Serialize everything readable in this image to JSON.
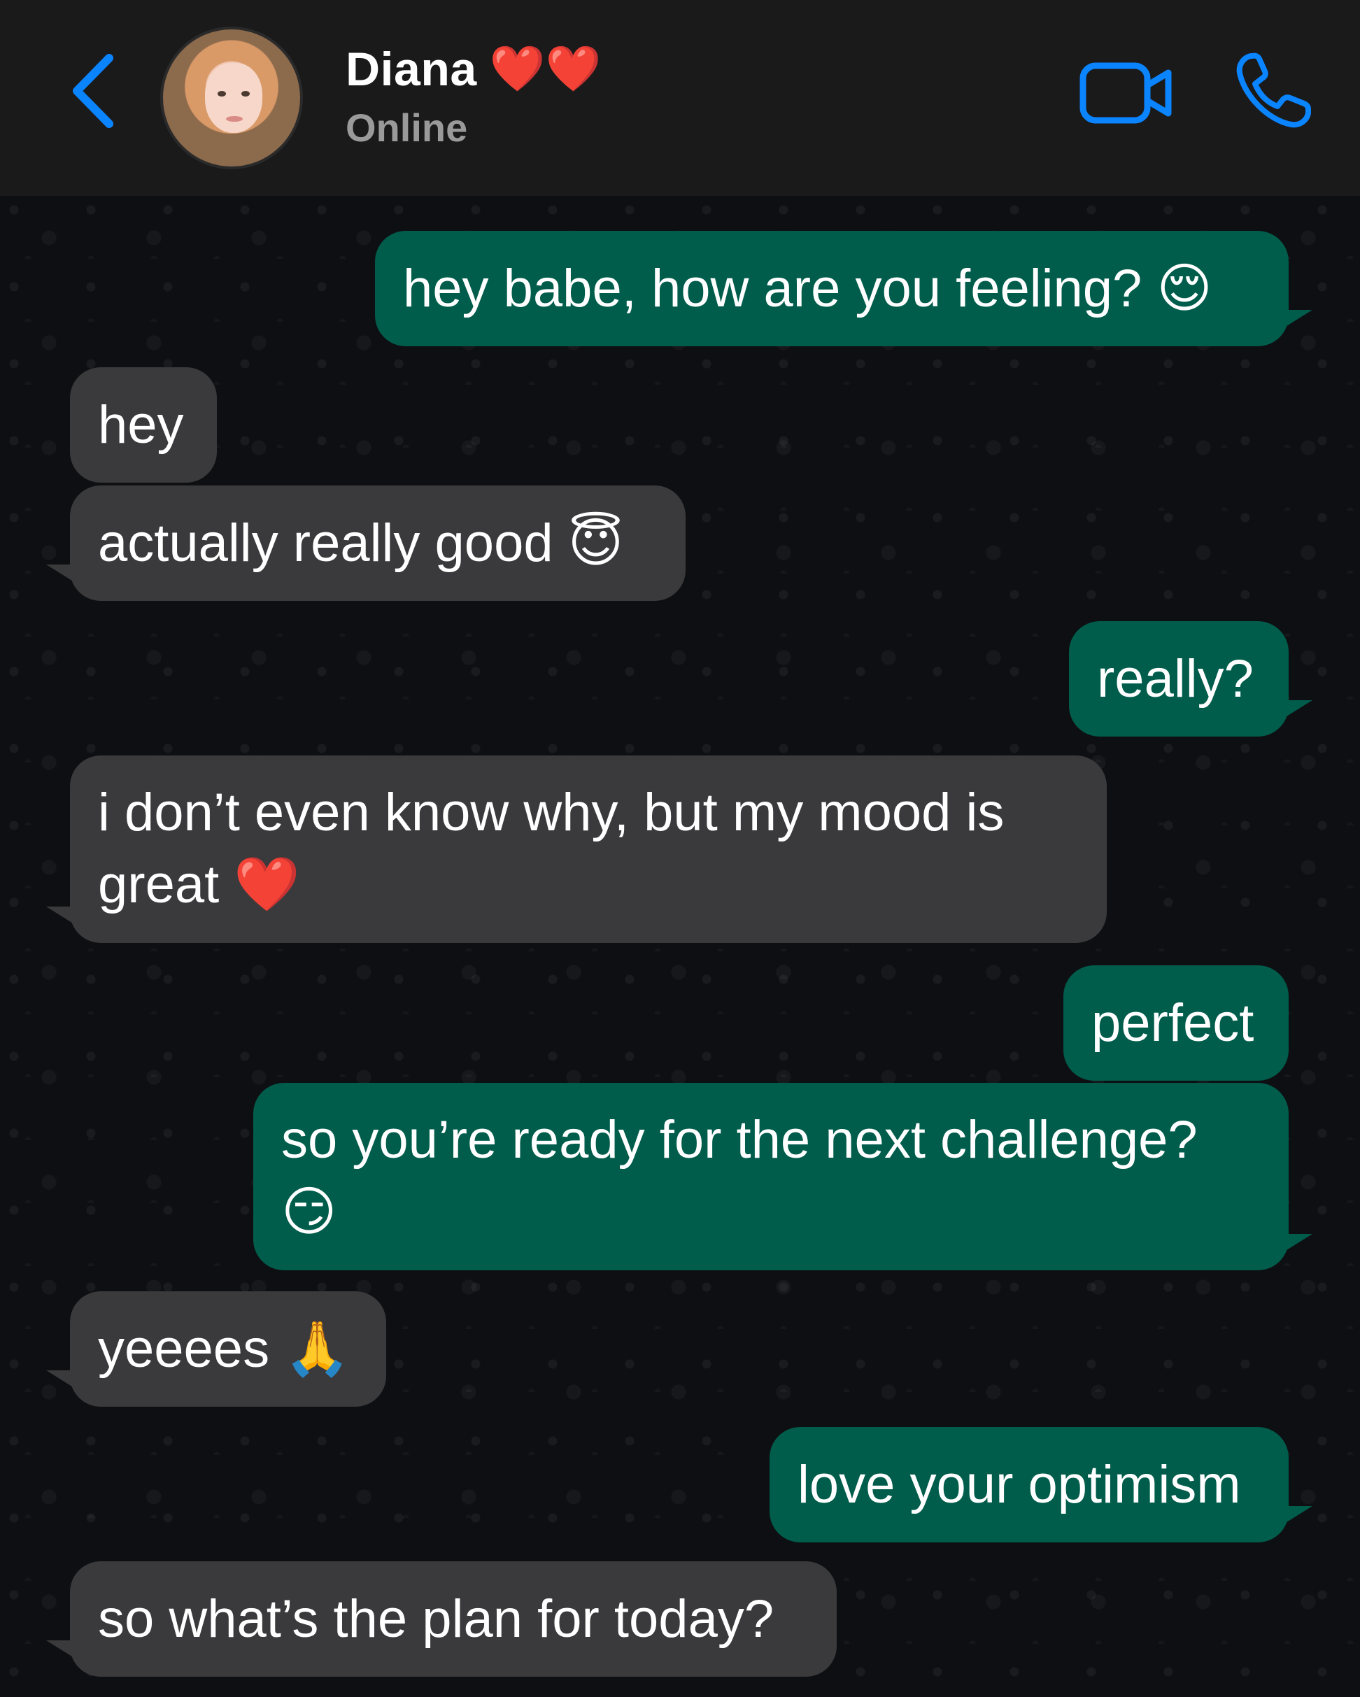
{
  "header": {
    "contact_name": "Diana",
    "name_emoji": "❤️❤️",
    "status": "Online",
    "accent_color": "#0a84ff",
    "icons": [
      "back-chevron-icon",
      "video-camera-icon",
      "phone-icon"
    ]
  },
  "messages": [
    {
      "direction": "sent",
      "text": "hey babe, how are you feeling? 😌"
    },
    {
      "direction": "received",
      "text": "hey"
    },
    {
      "direction": "received",
      "text": "actually really good 😇"
    },
    {
      "direction": "sent",
      "text": "really?"
    },
    {
      "direction": "received",
      "text": "i don’t even know why, but my mood is great ❤️"
    },
    {
      "direction": "sent",
      "text": "perfect"
    },
    {
      "direction": "sent",
      "text": "so you’re ready for the next challenge? 😏"
    },
    {
      "direction": "received",
      "text": "yeeees 🙏"
    },
    {
      "direction": "sent",
      "text": "love your optimism"
    },
    {
      "direction": "received",
      "text": "so what’s the plan for today?"
    }
  ],
  "colors": {
    "sent_bubble": "#005c4b",
    "received_bubble": "#3a3a3c",
    "header_bg": "#1a1a1b"
  }
}
